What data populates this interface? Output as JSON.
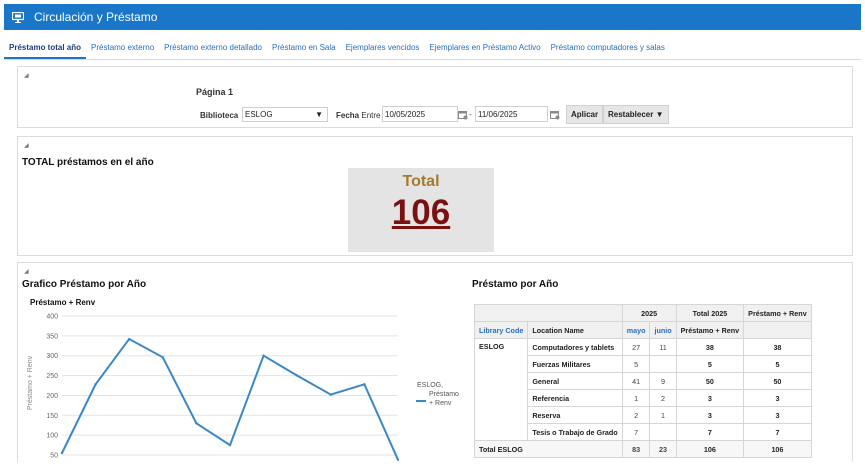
{
  "app": {
    "title": "Circulación y Préstamo",
    "icon": "monitor-icon"
  },
  "tabs": [
    "Préstamo total año",
    "Préstamo externo",
    "Préstamo externo detallado",
    "Préstamo en Sala",
    "Ejemplares vencidos",
    "Ejemplares en Préstamo Activo",
    "Préstamo computadores y salas"
  ],
  "filters": {
    "page_label": "Página 1",
    "library_label": "Biblioteca",
    "library_value": "ESLOG",
    "date_label": "Fecha",
    "between_label": "Entre",
    "date_from": "10/05/2025",
    "date_sep": "-",
    "date_to": "11/06/2025",
    "apply_label": "Aplicar",
    "reset_label": "Restablecer ▼"
  },
  "kpi": {
    "section_title": "TOTAL préstamos en el año",
    "label": "Total",
    "value": "106"
  },
  "chart": {
    "section_title": "Grafico Préstamo por Año",
    "measure_title": "Préstamo + Renv",
    "legend": [
      "ESLOG,",
      "Préstamo",
      "+ Renv"
    ],
    "series_color": "#3a87c6"
  },
  "chart_data": {
    "type": "line",
    "ylabel": "Préstamo + Renv",
    "ylim": [
      40,
      400
    ],
    "yticks": [
      400,
      350,
      300,
      250,
      200,
      150,
      100,
      50
    ],
    "series": [
      {
        "name": "ESLOG, Préstamo + Renv",
        "values": [
          55,
          228,
          342,
          296,
          130,
          75,
          300,
          250,
          202,
          228,
          38
        ]
      }
    ]
  },
  "pivot": {
    "title": "Préstamo por Año",
    "year": "2025",
    "total_year": "Total 2025",
    "measure": "Préstamo + Renv",
    "col_library": "Library Code",
    "col_location": "Location Name",
    "months": [
      "mayo",
      "junio"
    ],
    "sub_measure": "Préstamo + Renv",
    "library": "ESLOG",
    "rows": [
      {
        "location": "Computadores y tablets",
        "mayo": "27",
        "junio": "11",
        "total": "38",
        "measure": "38"
      },
      {
        "location": "Fuerzas Militares",
        "mayo": "5",
        "junio": "",
        "total": "5",
        "measure": "5"
      },
      {
        "location": "General",
        "mayo": "41",
        "junio": "9",
        "total": "50",
        "measure": "50"
      },
      {
        "location": "Referencia",
        "mayo": "1",
        "junio": "2",
        "total": "3",
        "measure": "3"
      },
      {
        "location": "Reserva",
        "mayo": "2",
        "junio": "1",
        "total": "3",
        "measure": "3"
      },
      {
        "location": "Tesis o Trabajo de Grado",
        "mayo": "7",
        "junio": "",
        "total": "7",
        "measure": "7"
      }
    ],
    "total_label": "Total ESLOG",
    "total_row": {
      "mayo": "83",
      "junio": "23",
      "total": "106",
      "measure": "106"
    }
  }
}
